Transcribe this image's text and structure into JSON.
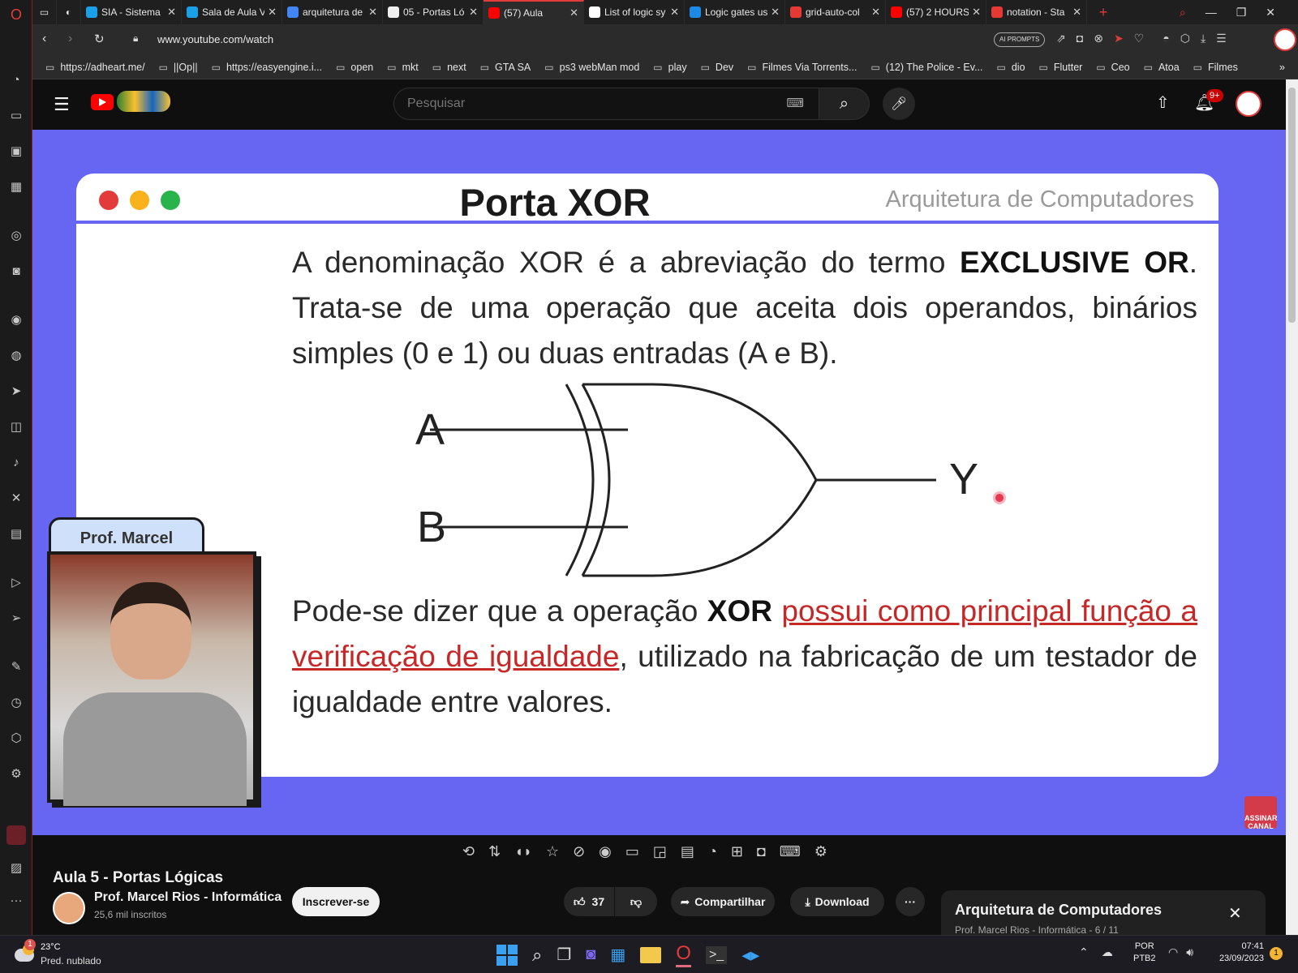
{
  "browser": {
    "tabs": [
      {
        "label": "SIA - Sistema",
        "color": "#1aa0e8"
      },
      {
        "label": "Sala de Aula V",
        "color": "#1aa0e8"
      },
      {
        "label": "arquitetura de",
        "color": "#4285f4"
      },
      {
        "label": "05 - Portas Ló",
        "color": "#eeeeee"
      },
      {
        "label": "(57) Aula",
        "color": "#ff0000",
        "active": true
      },
      {
        "label": "List of logic sy",
        "color": "#ffffff"
      },
      {
        "label": "Logic gates us",
        "color": "#1e88e5"
      },
      {
        "label": "grid-auto-col",
        "color": "#e53935"
      },
      {
        "label": "(57) 2 HOURS",
        "color": "#ff0000"
      },
      {
        "label": "notation - Sta",
        "color": "#e53935"
      }
    ],
    "new_tab_symbol": "+",
    "url": "www.youtube.com/watch",
    "ai_prompts": "AI PROMPTS",
    "bookmarks": [
      "https://adheart.me/",
      "||Op||",
      "https://easyengine.i...",
      "open",
      "mkt",
      "next",
      "GTA SA",
      "ps3 webMan mod",
      "play",
      "Dev",
      "Filmes Via Torrents...",
      "(12) The Police - Ev...",
      "dio",
      "Flutter",
      "Ceo",
      "Atoa",
      "Filmes"
    ],
    "overflow_symbol": "»"
  },
  "youtube": {
    "search_placeholder": "Pesquisar",
    "notification_count": "9+",
    "video_title": "Aula 5 - Portas Lógicas",
    "channel_name": "Prof. Marcel Rios - Informática",
    "subscribers": "25,6 mil inscritos",
    "subscribe_label": "Inscrever-se",
    "likes": "37",
    "share_label": "Compartilhar",
    "download_label": "Download",
    "more_symbol": "···",
    "playlist_title": "Arquitetura de Computadores",
    "playlist_meta": "Prof. Marcel Rios - Informática - 6 / 11",
    "close_symbol": "✕"
  },
  "slide": {
    "title": "Porta XOR",
    "subtitle": "Arquitetura de Computadores",
    "para1_a": "A denominação XOR é a abreviação do termo ",
    "para1_bold": "EXCLUSIVE OR",
    "para1_b": ".",
    "para1_c": "Trata-se de uma operação que aceita dois operandos, binários simples (0 e 1) ou duas entradas (A e B).",
    "input_a": "A",
    "input_b": "B",
    "output_y": "Y",
    "para2_a": "Pode-se dizer que a operação ",
    "para2_bold": "XOR",
    "para2_link": "possui como principal função a verificação de igualdade",
    "para2_b": ", utilizado na fabricação de um testador de igualdade entre valores.",
    "presenter_label": "Prof. Marcel",
    "subscribe_badge_1": "ASSINAR",
    "subscribe_badge_2": "CANAL"
  },
  "taskbar": {
    "temperature": "23°C",
    "weather": "Pred. nublado",
    "weather_badge": "1",
    "lang_1": "POR",
    "lang_2": "PTB2",
    "time": "07:41",
    "date": "23/09/2023",
    "notif_badge": "1"
  },
  "colors": {
    "slide_bg": "#6666f2",
    "link_red": "#c62828",
    "youtube_red": "#ff0000"
  }
}
